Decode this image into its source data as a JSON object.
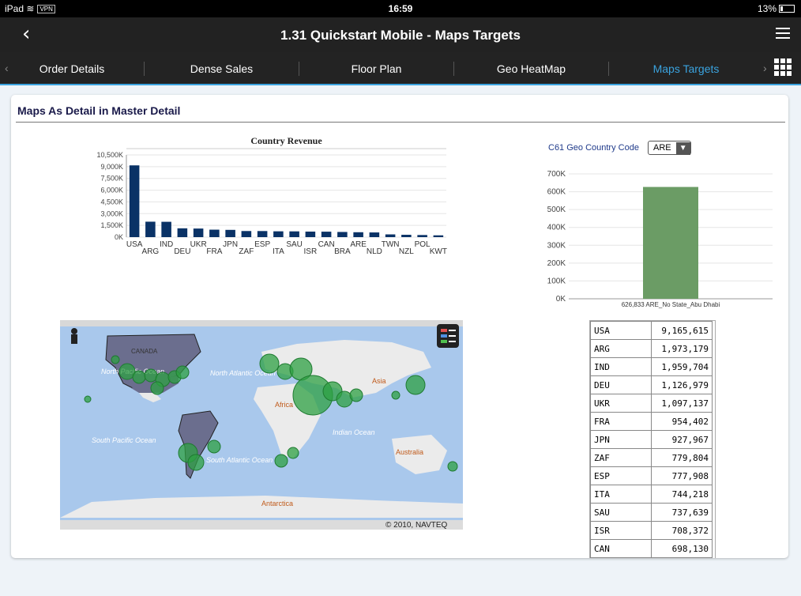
{
  "status": {
    "device": "iPad",
    "vpn": "VPN",
    "time": "16:59",
    "battery": "13%"
  },
  "header": {
    "back_glyph": "‹",
    "title": "1.31 Quickstart Mobile - Maps Targets"
  },
  "tabs": [
    {
      "label": "Order Details"
    },
    {
      "label": "Dense Sales"
    },
    {
      "label": "Floor Plan"
    },
    {
      "label": "Geo HeatMap"
    },
    {
      "label": "Maps Targets",
      "active": true
    }
  ],
  "section": {
    "title": "Maps As Detail in Master Detail"
  },
  "filter": {
    "label": "C61 Geo Country Code",
    "value": "ARE"
  },
  "map": {
    "credit": "© 2010, NAVTEQ",
    "labels": [
      "CANADA",
      "North Pacific Ocean",
      "North Atlantic Ocean",
      "South Pacific Ocean",
      "South Atlantic Ocean",
      "Indian Ocean",
      "Asia",
      "Australia",
      "Africa",
      "Antarctica"
    ]
  },
  "colors": {
    "bar1": "#0a3266",
    "bar2": "#6b9c65",
    "accent": "#3aa3df",
    "bubble": "#2ea043"
  },
  "chart_data": [
    {
      "type": "bar",
      "title": "Country Revenue",
      "categories": [
        "USA",
        "ARG",
        "IND",
        "DEU",
        "UKR",
        "FRA",
        "JPN",
        "ZAF",
        "ESP",
        "ITA",
        "SAU",
        "ISR",
        "CAN",
        "BRA",
        "ARE",
        "NLD",
        "TWN",
        "NZL",
        "POL",
        "KWT"
      ],
      "values": [
        9165615,
        1973179,
        1959704,
        1126979,
        1097137,
        954402,
        927967,
        779804,
        777908,
        744218,
        737639,
        708372,
        698130,
        660000,
        626833,
        600000,
        350000,
        300000,
        270000,
        230000
      ],
      "yticks": [
        "0K",
        "1,500K",
        "3,000K",
        "4,500K",
        "6,000K",
        "7,500K",
        "9,000K",
        "10,500K"
      ],
      "ylim": [
        0,
        10500000
      ]
    },
    {
      "type": "bar",
      "categories": [
        "626,833 ARE_No State_Abu Dhabi"
      ],
      "values": [
        626833
      ],
      "yticks": [
        "0K",
        "100K",
        "200K",
        "300K",
        "400K",
        "500K",
        "600K",
        "700K"
      ],
      "ylim": [
        0,
        700000
      ]
    }
  ],
  "table_rows": [
    {
      "c": "USA",
      "v": "9,165,615"
    },
    {
      "c": "ARG",
      "v": "1,973,179"
    },
    {
      "c": "IND",
      "v": "1,959,704"
    },
    {
      "c": "DEU",
      "v": "1,126,979"
    },
    {
      "c": "UKR",
      "v": "1,097,137"
    },
    {
      "c": "FRA",
      "v": "954,402"
    },
    {
      "c": "JPN",
      "v": "927,967"
    },
    {
      "c": "ZAF",
      "v": "779,804"
    },
    {
      "c": "ESP",
      "v": "777,908"
    },
    {
      "c": "ITA",
      "v": "744,218"
    },
    {
      "c": "SAU",
      "v": "737,639"
    },
    {
      "c": "ISR",
      "v": "708,372"
    },
    {
      "c": "CAN",
      "v": "698,130"
    }
  ]
}
